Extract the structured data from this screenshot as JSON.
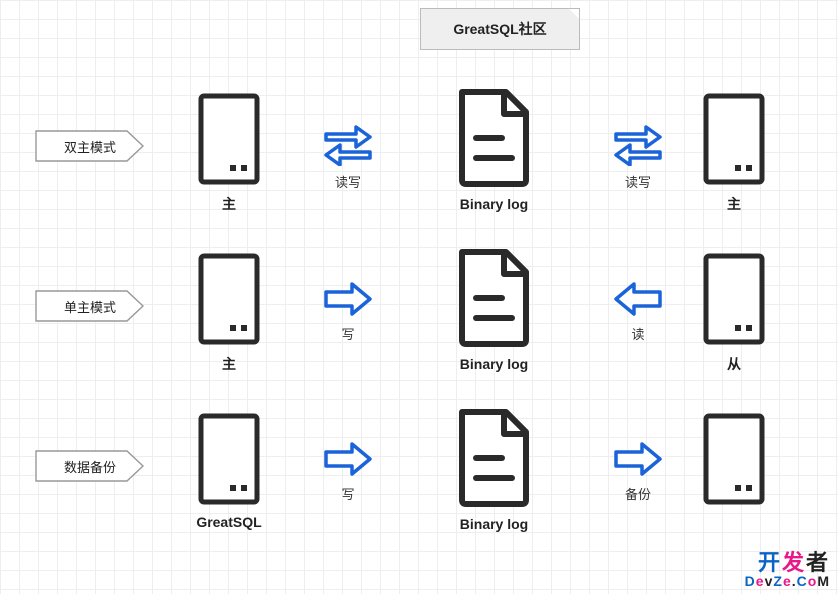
{
  "header": {
    "title": "GreatSQL社区"
  },
  "rows": [
    {
      "label": "双主模式",
      "left_server": "主",
      "arrow_left_type": "bidir",
      "arrow_left_label": "读写",
      "center": "Binary log",
      "arrow_right_type": "bidir",
      "arrow_right_label": "读写",
      "right_server": "主"
    },
    {
      "label": "单主模式",
      "left_server": "主",
      "arrow_left_type": "right",
      "arrow_left_label": "写",
      "center": "Binary log",
      "arrow_right_type": "left",
      "arrow_right_label": "读",
      "right_server": "从"
    },
    {
      "label": "数据备份",
      "left_server": "GreatSQL",
      "arrow_left_type": "right",
      "arrow_left_label": "写",
      "center": "Binary log",
      "arrow_right_type": "right",
      "arrow_right_label": "备份",
      "right_server": ""
    }
  ],
  "watermark": {
    "line1": "开发者",
    "line2": "DevZe.CoM"
  },
  "colors": {
    "arrow": "#1b63d8",
    "icon": "#2a2a2a"
  }
}
